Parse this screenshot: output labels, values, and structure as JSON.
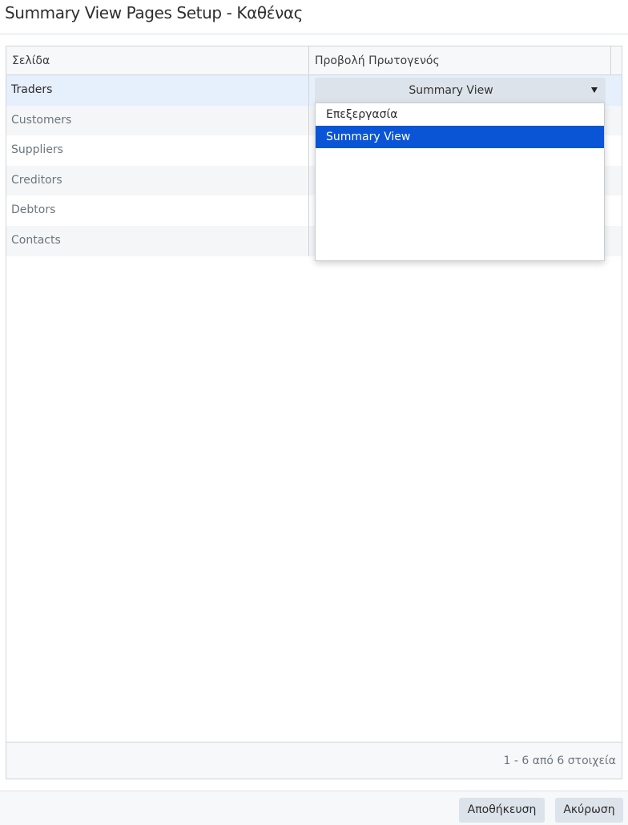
{
  "window": {
    "title": "Summary View Pages Setup - Καθένας"
  },
  "grid": {
    "columns": {
      "page": "Σελίδα",
      "primary_view": "Προβολή Πρωτογενός"
    },
    "rows": [
      {
        "page": "Traders",
        "primary_view": "Summary View"
      },
      {
        "page": "Customers"
      },
      {
        "page": "Suppliers"
      },
      {
        "page": "Creditors"
      },
      {
        "page": "Debtors"
      },
      {
        "page": "Contacts"
      }
    ],
    "selected_row": 0,
    "dropdown": {
      "options": [
        "Επεξεργασία",
        "Summary View"
      ],
      "highlighted": 1,
      "arrow_icon": "caret-down-icon"
    },
    "pager": {
      "info": "1 - 6 από 6 στοιχεία"
    }
  },
  "actions": {
    "save_label": "Αποθήκευση",
    "cancel_label": "Ακύρωση"
  },
  "colors": {
    "accent": "#0a54d6",
    "selected_row": "#e6effc",
    "button_bg": "#dde3ea"
  }
}
